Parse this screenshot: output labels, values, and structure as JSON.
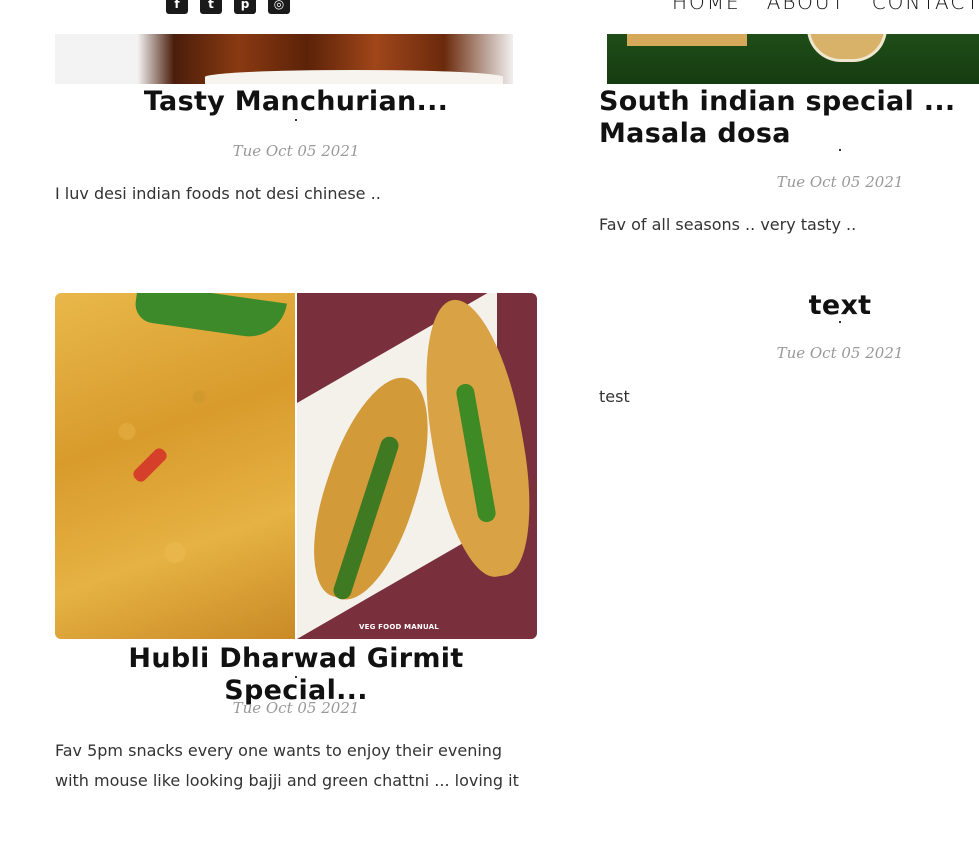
{
  "header": {
    "social": [
      {
        "icon": "facebook-icon",
        "glyph": "f"
      },
      {
        "icon": "twitter-icon",
        "glyph": "t"
      },
      {
        "icon": "pinterest-icon",
        "glyph": "p"
      },
      {
        "icon": "instagram-icon",
        "glyph": "◎"
      }
    ],
    "nav": [
      {
        "label": "HOME"
      },
      {
        "label": "ABOUT"
      },
      {
        "label": "CONTACT"
      }
    ]
  },
  "posts": [
    {
      "title": "Tasty Manchurian...",
      "date": "Tue Oct 05 2021",
      "excerpt": "I luv desi indian foods not desi chinese .."
    },
    {
      "title": "South indian special ... Masala dosa",
      "date": "Tue Oct 05 2021",
      "excerpt": "Fav of all seasons .. very tasty .."
    },
    {
      "title": "Hubli Dharwad Girmit Special...",
      "date": "Tue Oct 05 2021",
      "excerpt": "Fav 5pm snacks every one wants to enjoy their evening with mouse like looking bajji and green chattni ... loving it",
      "image_watermark": "VEG FOOD MANUAL"
    },
    {
      "title": "text",
      "date": "Tue Oct 05 2021",
      "excerpt": "test"
    }
  ]
}
